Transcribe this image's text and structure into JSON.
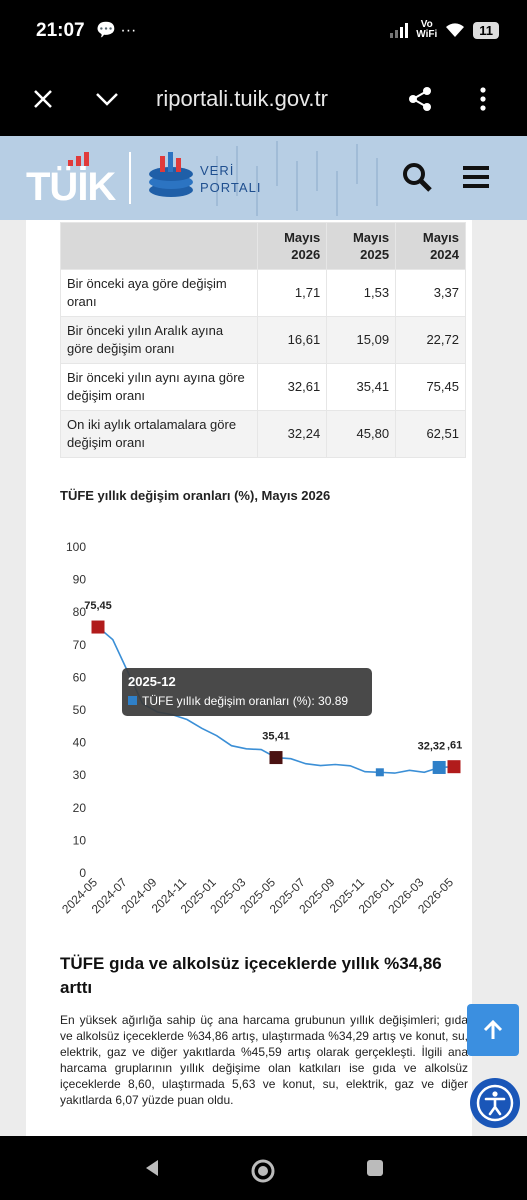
{
  "status_bar": {
    "time": "21:07",
    "vowifi_top": "Vo",
    "vowifi_bottom": "WiFi",
    "battery": "11"
  },
  "browser": {
    "url": "riportali.tuik.gov.tr"
  },
  "site": {
    "logo_text": "TÜİK",
    "portal_line1": "VERİ",
    "portal_line2": "PORTALI"
  },
  "table": {
    "headers": [
      {
        "line1": "",
        "line2": ""
      },
      {
        "line1": "Mayıs",
        "line2": "2026"
      },
      {
        "line1": "Mayıs",
        "line2": "2025"
      },
      {
        "line1": "Mayıs",
        "line2": "2024"
      }
    ],
    "rows": [
      {
        "label": "Bir önceki aya göre değişim oranı",
        "v2026": "1,71",
        "v2025": "1,53",
        "v2024": "3,37"
      },
      {
        "label": "Bir önceki yılın Aralık ayına göre değişim oranı",
        "v2026": "16,61",
        "v2025": "15,09",
        "v2024": "22,72"
      },
      {
        "label": "Bir önceki yılın aynı ayına göre değişim oranı",
        "v2026": "32,61",
        "v2025": "35,41",
        "v2024": "75,45"
      },
      {
        "label": "On iki aylık ortalamalara göre değişim oranı",
        "v2026": "32,24",
        "v2025": "45,80",
        "v2024": "62,51"
      }
    ]
  },
  "chart_data": {
    "type": "line",
    "title": "TÜFE yıllık değişim oranları (%), Mayıs 2026",
    "series_name": "TÜFE yıllık değişim oranları (%)",
    "x": [
      "2024-05",
      "2024-06",
      "2024-07",
      "2024-08",
      "2024-09",
      "2024-10",
      "2024-11",
      "2024-12",
      "2025-01",
      "2025-02",
      "2025-03",
      "2025-04",
      "2025-05",
      "2025-06",
      "2025-07",
      "2025-08",
      "2025-09",
      "2025-10",
      "2025-11",
      "2025-12",
      "2026-01",
      "2026-02",
      "2026-03",
      "2026-04",
      "2026-05"
    ],
    "y": [
      75.45,
      71.6,
      61.78,
      51.97,
      49.38,
      48.58,
      47.09,
      44.38,
      42.12,
      39.05,
      38.1,
      37.86,
      35.41,
      35.05,
      33.52,
      32.95,
      33.29,
      32.87,
      31.07,
      30.89,
      30.65,
      31.5,
      30.9,
      32.37,
      32.61
    ],
    "xticks": [
      "2024-05",
      "2024-07",
      "2024-09",
      "2024-11",
      "2025-01",
      "2025-03",
      "2025-05",
      "2025-07",
      "2025-09",
      "2025-11",
      "2026-01",
      "2026-03",
      "2026-05"
    ],
    "yticks": [
      "0",
      "10",
      "20",
      "30",
      "40",
      "50",
      "60",
      "70",
      "80",
      "90",
      "100"
    ],
    "ylim": [
      0,
      100
    ],
    "annotations": [
      {
        "x": "2024-05",
        "label": "75,45"
      },
      {
        "x": "2025-05",
        "label": "35,41"
      },
      {
        "x": "2026-04",
        "label": "32,32"
      },
      {
        "x": "2026-05",
        "label": ",61"
      }
    ],
    "tooltip": {
      "title": "2025-12",
      "text": "TÜFE yıllık değişim oranları (%): 30.89"
    },
    "line_color": "#3b8fd6",
    "marker_red": "#b11b1b",
    "marker_blue": "#2f80c8"
  },
  "article": {
    "heading": "TÜFE gıda ve alkolsüz içeceklerde yıllık %34,86 arttı",
    "paragraph": "En yüksek ağırlığa sahip üç ana harcama grubunun yıllık değişimleri; gıda ve alkolsüz içeceklerde %34,86 artış, ulaştırmada %34,29 artış ve konut, su, elektrik, gaz ve diğer yakıtlarda %45,59 artış olarak gerçekleşti. İlgili ana harcama gruplarının yıllık değişime olan katkıları ise gıda ve alkolsüz içeceklerde 8,60, ulaştırmada 5,63 ve konut, su, elektrik, gaz ve diğer yakıtlarda 6,07 yüzde puan oldu."
  }
}
